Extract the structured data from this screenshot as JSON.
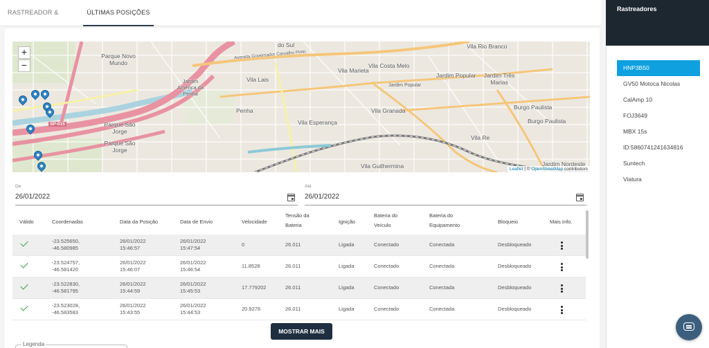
{
  "tabs": [
    {
      "label": "RASTREADOR & VEÍCULO",
      "active": false
    },
    {
      "label": "ÚLTIMAS POSIÇÕES",
      "active": true
    }
  ],
  "map": {
    "zoom_in": "+",
    "zoom_out": "−",
    "labels": [
      "do Sul",
      "Parque Novo Mundo",
      "Jardim América da Penha",
      "Vila Lais",
      "Penha",
      "Parque São Jorge",
      "Parque São Jorge",
      "Vila Esperança",
      "Vila Marieta",
      "Vila Costa Melo",
      "Jardim Popular",
      "Jardim Popular",
      "Jardim Três Marias",
      "Vila Granada",
      "Burgo Paulista",
      "Burgo Paulista",
      "Vila Re",
      "Vila Guilhermina",
      "Vila Rio Branco",
      "SP-015",
      "Jardim Nordeste",
      "Avenida Governador Carvalho Pinto"
    ],
    "attribution": {
      "leaflet": "Leaflet",
      "sep": " | © ",
      "osm": "OpenStreetMap",
      "rest": " contributors"
    }
  },
  "filters": {
    "from_label": "De",
    "from_value": "26/01/2022",
    "to_label": "Até",
    "to_value": "26/01/2022"
  },
  "table": {
    "headers": [
      "Válido",
      "Coordenadas",
      "Data da Posição",
      "Data de Envio",
      "Velocidade",
      "Tensão da\nBateria",
      "Ignição",
      "Bateria do\nVeículo",
      "Bateria do\nEquipamento",
      "Bloqueio",
      "Mais Info."
    ],
    "rows": [
      {
        "coords": "-23.525650,\n-46.580985",
        "pos_date": "26/01/2022\n15:46:57",
        "send_date": "26/01/2022\n15:47:54",
        "speed": "0",
        "voltage": "26.011",
        "ignition": "Ligada",
        "vehicle_batt": "Conectado",
        "device_batt": "Conectada",
        "lock": "Desbloqueado"
      },
      {
        "coords": "-23.524757,\n-46.581420",
        "pos_date": "26/01/2022\n15:46:07",
        "send_date": "26/01/2022\n15:46:54",
        "speed": "11.8528",
        "voltage": "26.011",
        "ignition": "Ligada",
        "vehicle_batt": "Conectado",
        "device_batt": "Conectada",
        "lock": "Desbloqueado"
      },
      {
        "coords": "-23.522830,\n-46.581795",
        "pos_date": "26/01/2022\n15:44:59",
        "send_date": "26/01/2022\n15:45:53",
        "speed": "17.779202",
        "voltage": "26.011",
        "ignition": "Ligada",
        "vehicle_batt": "Conectado",
        "device_batt": "Conectada",
        "lock": "Desbloqueado"
      },
      {
        "coords": "-23.523028,\n-46.583583",
        "pos_date": "26/01/2022\n15:43:55",
        "send_date": "26/01/2022\n15:44:53",
        "speed": "20.9276",
        "voltage": "26.011",
        "ignition": "Ligada",
        "vehicle_batt": "Conectado",
        "device_batt": "Conectada",
        "lock": "Desbloqueado"
      }
    ]
  },
  "show_more_label": "MOSTRAR MAIS",
  "legend_label": "Legenda",
  "sidebar": {
    "title": "Rastreadores",
    "items": [
      "HNP3B50",
      "GV50 Motoca Nicolas",
      "CalAmp 10",
      "FOJ3649",
      "MBX 15s",
      "ID:5860741241634816",
      "Suntech",
      "Viatura"
    ],
    "active_index": 0
  },
  "colors": {
    "accent": "#0fa0e0",
    "header_dark": "#1d2730",
    "button_dark": "#1f2f40",
    "pin": "#2e86c8",
    "valid": "#3a9a3a"
  }
}
